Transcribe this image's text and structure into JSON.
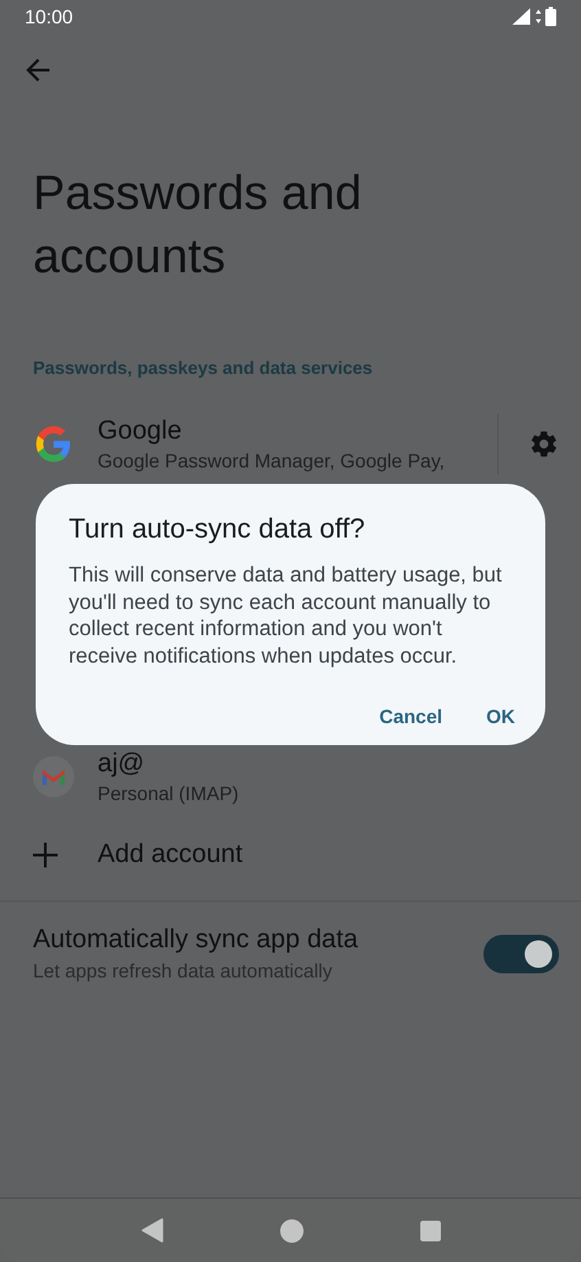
{
  "status_bar": {
    "time": "10:00"
  },
  "title": "Passwords and accounts",
  "section_header": "Passwords, passkeys and data services",
  "accounts": [
    {
      "kind": "google",
      "name": "Google",
      "detail": "Google Password Manager, Google Pay,",
      "settings": true
    },
    {
      "kind": "gmail",
      "name": "aj@",
      "detail": "Personal (IMAP)",
      "settings": false
    }
  ],
  "add_account": "Add account",
  "sync": {
    "title": "Automatically sync app data",
    "subtitle": "Let apps refresh data automatically",
    "on": true
  },
  "dialog": {
    "title": "Turn auto-sync data off?",
    "message": "This will conserve data and battery usage, but you'll need to sync each account manually to collect recent information and you won't receive notifications when updates occur.",
    "buttons": [
      "Cancel",
      "OK"
    ]
  }
}
